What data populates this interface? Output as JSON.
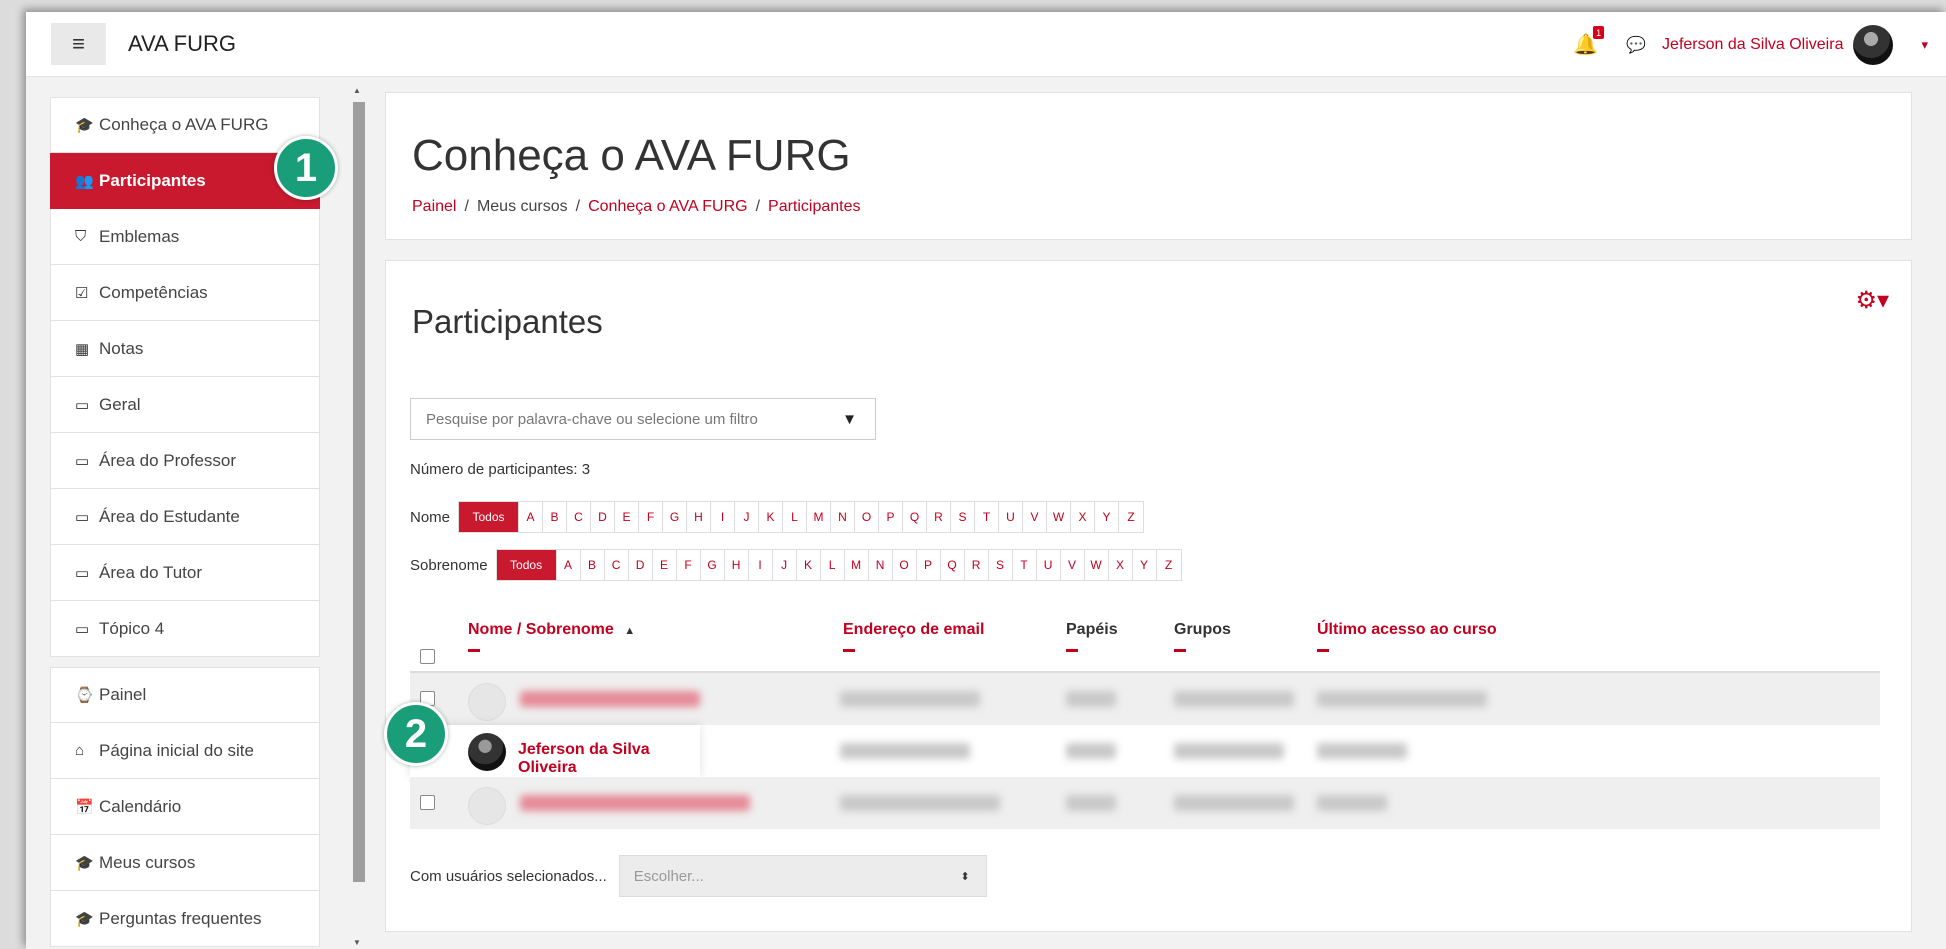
{
  "navbar": {
    "site_name": "AVA FURG",
    "hamburger": "≡",
    "notification_count": "1",
    "user_name": "Jeferson da Silva Oliveira",
    "caret": "▾"
  },
  "sidebar": {
    "items": [
      {
        "icon": "🎓",
        "label": "Conheça o AVA FURG"
      },
      {
        "icon": "👥",
        "label": "Participantes",
        "active": true
      },
      {
        "icon": "⛉",
        "label": "Emblemas"
      },
      {
        "icon": "☑",
        "label": "Competências"
      },
      {
        "icon": "▦",
        "label": "Notas"
      },
      {
        "icon": "▭",
        "label": "Geral"
      },
      {
        "icon": "▭",
        "label": "Área do Professor"
      },
      {
        "icon": "▭",
        "label": "Área do Estudante"
      },
      {
        "icon": "▭",
        "label": "Área do Tutor"
      },
      {
        "icon": "▭",
        "label": "Tópico 4"
      }
    ],
    "items2": [
      {
        "icon": "⌚",
        "label": "Painel"
      },
      {
        "icon": "⌂",
        "label": "Página inicial do site"
      },
      {
        "icon": "📅",
        "label": "Calendário"
      },
      {
        "icon": "🎓",
        "label": "Meus cursos"
      },
      {
        "icon": "🎓",
        "label": "Perguntas frequentes"
      }
    ]
  },
  "header": {
    "title": "Conheça o AVA FURG",
    "breadcrumb": [
      "Painel",
      "Meus cursos",
      "Conheça o AVA FURG",
      "Participantes"
    ],
    "sep": "/"
  },
  "participants": {
    "title": "Participantes",
    "filter_placeholder": "Pesquise por palavra-chave ou selecione um filtro",
    "filter_arrow": "▼",
    "count_text": "Número de participantes: 3",
    "nome_label": "Nome",
    "sobrenome_label": "Sobrenome",
    "todos": "Todos",
    "letters": [
      "A",
      "B",
      "C",
      "D",
      "E",
      "F",
      "G",
      "H",
      "I",
      "J",
      "K",
      "L",
      "M",
      "N",
      "O",
      "P",
      "Q",
      "R",
      "S",
      "T",
      "U",
      "V",
      "W",
      "X",
      "Y",
      "Z"
    ],
    "columns": {
      "name": "Nome / Sobrenome",
      "sort_indicator": "▲",
      "email": "Endereço de email",
      "roles": "Papéis",
      "groups": "Grupos",
      "last_access": "Último acesso ao curso"
    },
    "visible_user": "Jeferson da Silva Oliveira",
    "bulk_label": "Com usuários selecionados...",
    "bulk_placeholder": "Escolher...",
    "bulk_arrow": "⬍"
  },
  "steps": {
    "one": "1",
    "two": "2"
  },
  "colors": {
    "accent": "#c9192e",
    "step": "#1a9e7a"
  }
}
